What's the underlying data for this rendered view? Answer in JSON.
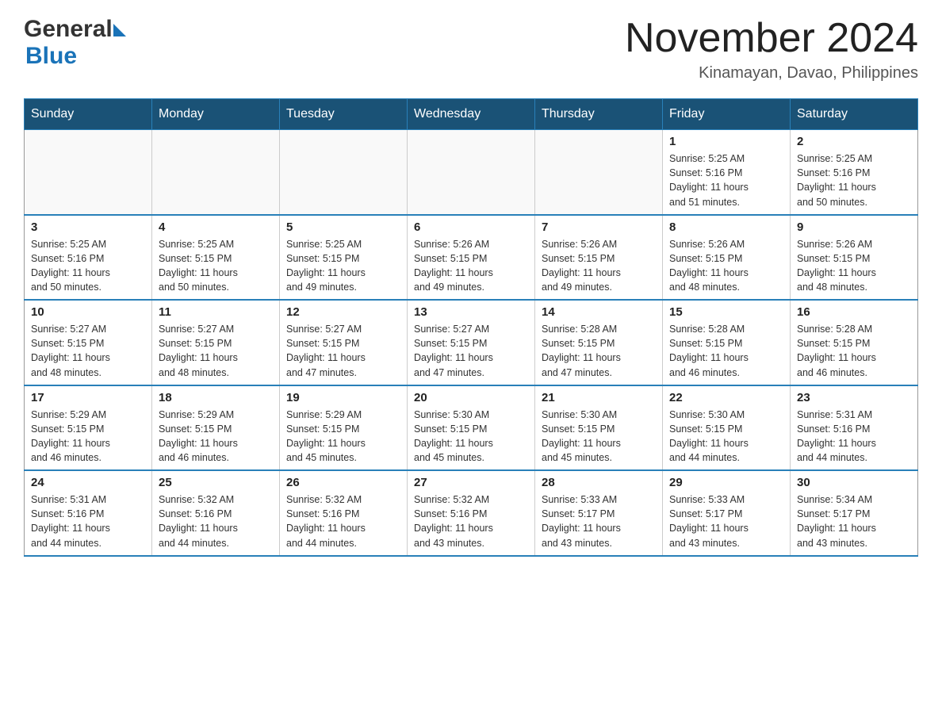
{
  "logo": {
    "general": "General",
    "blue": "Blue"
  },
  "title": "November 2024",
  "subtitle": "Kinamayan, Davao, Philippines",
  "days_of_week": [
    "Sunday",
    "Monday",
    "Tuesday",
    "Wednesday",
    "Thursday",
    "Friday",
    "Saturday"
  ],
  "weeks": [
    [
      {
        "day": "",
        "info": ""
      },
      {
        "day": "",
        "info": ""
      },
      {
        "day": "",
        "info": ""
      },
      {
        "day": "",
        "info": ""
      },
      {
        "day": "",
        "info": ""
      },
      {
        "day": "1",
        "info": "Sunrise: 5:25 AM\nSunset: 5:16 PM\nDaylight: 11 hours\nand 51 minutes."
      },
      {
        "day": "2",
        "info": "Sunrise: 5:25 AM\nSunset: 5:16 PM\nDaylight: 11 hours\nand 50 minutes."
      }
    ],
    [
      {
        "day": "3",
        "info": "Sunrise: 5:25 AM\nSunset: 5:16 PM\nDaylight: 11 hours\nand 50 minutes."
      },
      {
        "day": "4",
        "info": "Sunrise: 5:25 AM\nSunset: 5:15 PM\nDaylight: 11 hours\nand 50 minutes."
      },
      {
        "day": "5",
        "info": "Sunrise: 5:25 AM\nSunset: 5:15 PM\nDaylight: 11 hours\nand 49 minutes."
      },
      {
        "day": "6",
        "info": "Sunrise: 5:26 AM\nSunset: 5:15 PM\nDaylight: 11 hours\nand 49 minutes."
      },
      {
        "day": "7",
        "info": "Sunrise: 5:26 AM\nSunset: 5:15 PM\nDaylight: 11 hours\nand 49 minutes."
      },
      {
        "day": "8",
        "info": "Sunrise: 5:26 AM\nSunset: 5:15 PM\nDaylight: 11 hours\nand 48 minutes."
      },
      {
        "day": "9",
        "info": "Sunrise: 5:26 AM\nSunset: 5:15 PM\nDaylight: 11 hours\nand 48 minutes."
      }
    ],
    [
      {
        "day": "10",
        "info": "Sunrise: 5:27 AM\nSunset: 5:15 PM\nDaylight: 11 hours\nand 48 minutes."
      },
      {
        "day": "11",
        "info": "Sunrise: 5:27 AM\nSunset: 5:15 PM\nDaylight: 11 hours\nand 48 minutes."
      },
      {
        "day": "12",
        "info": "Sunrise: 5:27 AM\nSunset: 5:15 PM\nDaylight: 11 hours\nand 47 minutes."
      },
      {
        "day": "13",
        "info": "Sunrise: 5:27 AM\nSunset: 5:15 PM\nDaylight: 11 hours\nand 47 minutes."
      },
      {
        "day": "14",
        "info": "Sunrise: 5:28 AM\nSunset: 5:15 PM\nDaylight: 11 hours\nand 47 minutes."
      },
      {
        "day": "15",
        "info": "Sunrise: 5:28 AM\nSunset: 5:15 PM\nDaylight: 11 hours\nand 46 minutes."
      },
      {
        "day": "16",
        "info": "Sunrise: 5:28 AM\nSunset: 5:15 PM\nDaylight: 11 hours\nand 46 minutes."
      }
    ],
    [
      {
        "day": "17",
        "info": "Sunrise: 5:29 AM\nSunset: 5:15 PM\nDaylight: 11 hours\nand 46 minutes."
      },
      {
        "day": "18",
        "info": "Sunrise: 5:29 AM\nSunset: 5:15 PM\nDaylight: 11 hours\nand 46 minutes."
      },
      {
        "day": "19",
        "info": "Sunrise: 5:29 AM\nSunset: 5:15 PM\nDaylight: 11 hours\nand 45 minutes."
      },
      {
        "day": "20",
        "info": "Sunrise: 5:30 AM\nSunset: 5:15 PM\nDaylight: 11 hours\nand 45 minutes."
      },
      {
        "day": "21",
        "info": "Sunrise: 5:30 AM\nSunset: 5:15 PM\nDaylight: 11 hours\nand 45 minutes."
      },
      {
        "day": "22",
        "info": "Sunrise: 5:30 AM\nSunset: 5:15 PM\nDaylight: 11 hours\nand 44 minutes."
      },
      {
        "day": "23",
        "info": "Sunrise: 5:31 AM\nSunset: 5:16 PM\nDaylight: 11 hours\nand 44 minutes."
      }
    ],
    [
      {
        "day": "24",
        "info": "Sunrise: 5:31 AM\nSunset: 5:16 PM\nDaylight: 11 hours\nand 44 minutes."
      },
      {
        "day": "25",
        "info": "Sunrise: 5:32 AM\nSunset: 5:16 PM\nDaylight: 11 hours\nand 44 minutes."
      },
      {
        "day": "26",
        "info": "Sunrise: 5:32 AM\nSunset: 5:16 PM\nDaylight: 11 hours\nand 44 minutes."
      },
      {
        "day": "27",
        "info": "Sunrise: 5:32 AM\nSunset: 5:16 PM\nDaylight: 11 hours\nand 43 minutes."
      },
      {
        "day": "28",
        "info": "Sunrise: 5:33 AM\nSunset: 5:17 PM\nDaylight: 11 hours\nand 43 minutes."
      },
      {
        "day": "29",
        "info": "Sunrise: 5:33 AM\nSunset: 5:17 PM\nDaylight: 11 hours\nand 43 minutes."
      },
      {
        "day": "30",
        "info": "Sunrise: 5:34 AM\nSunset: 5:17 PM\nDaylight: 11 hours\nand 43 minutes."
      }
    ]
  ]
}
